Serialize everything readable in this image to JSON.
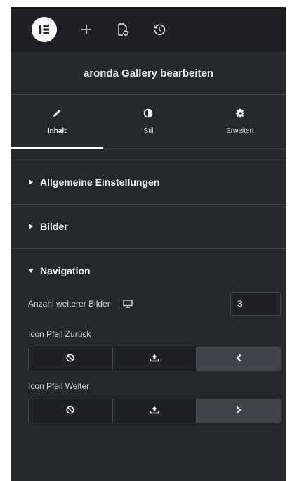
{
  "topbar": {
    "logo_icon": "elementor-logo-icon",
    "add_icon": "plus-icon",
    "page_settings_icon": "page-settings-icon",
    "history_icon": "history-icon"
  },
  "panel": {
    "title": "aronda Gallery bearbeiten"
  },
  "tabs": [
    {
      "label": "Inhalt",
      "icon": "pencil-icon",
      "active": true
    },
    {
      "label": "Stil",
      "icon": "half-circle-icon",
      "active": false
    },
    {
      "label": "Erweitert",
      "icon": "gear-icon",
      "active": false
    }
  ],
  "sections": {
    "general": {
      "title": "Allgemeine Einstellungen",
      "expanded": false
    },
    "images": {
      "title": "Bilder",
      "expanded": false
    },
    "navigation": {
      "title": "Navigation",
      "expanded": true
    }
  },
  "navigation": {
    "more_images": {
      "label": "Anzahl weiterer Bilder",
      "value": "3",
      "device_icon": "desktop-icon"
    },
    "icon_back": {
      "label": "Icon Pfeil Zurück",
      "options": [
        "ban-icon",
        "upload-icon",
        "chevron-left-icon"
      ],
      "selected": 2
    },
    "icon_next": {
      "label": "Icon Pfeil Weiter",
      "options": [
        "ban-icon",
        "upload-icon",
        "chevron-right-icon"
      ],
      "selected": 2
    }
  },
  "colors": {
    "panel_bg": "#26292c",
    "topbar_bg": "#1f2124",
    "divider": "#3d4045",
    "selected_choice": "#3f444b",
    "text": "#d5d8dc"
  }
}
